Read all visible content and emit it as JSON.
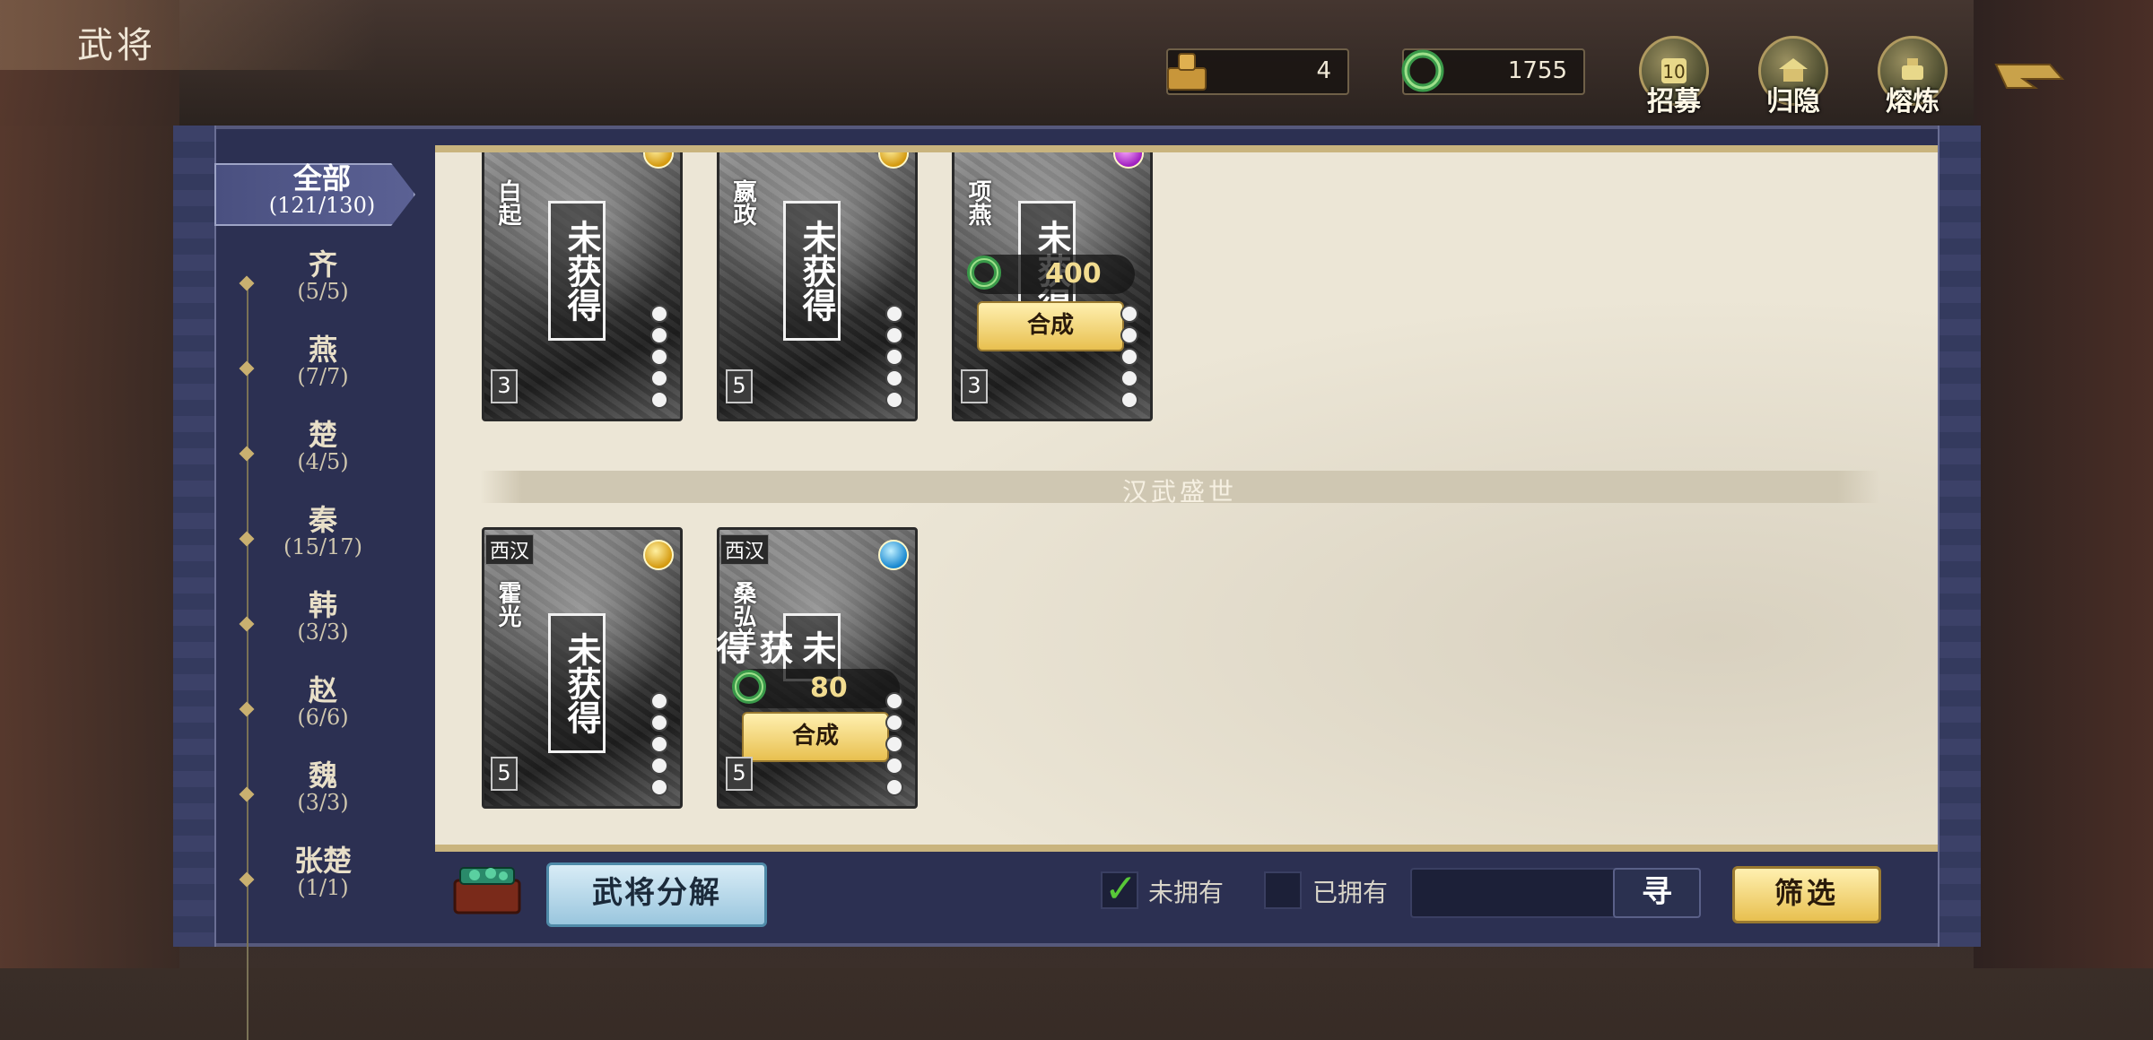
{
  "header": {
    "title": "武将",
    "currency_token": {
      "icon": "seal-token-icon",
      "value": "4"
    },
    "currency_jade": {
      "icon": "jade-ring-icon",
      "value": "1755"
    },
    "buttons": [
      {
        "label": "招募",
        "icon": "recruit-icon"
      },
      {
        "label": "归隐",
        "icon": "retire-house-icon"
      },
      {
        "label": "熔炼",
        "icon": "smelt-cauldron-icon"
      }
    ],
    "back_icon": "back-arrow-icon"
  },
  "sidebar": {
    "items": [
      {
        "name": "全部",
        "count": "(121/130)",
        "active": true
      },
      {
        "name": "齐",
        "count": "(5/5)"
      },
      {
        "name": "燕",
        "count": "(7/7)"
      },
      {
        "name": "楚",
        "count": "(4/5)"
      },
      {
        "name": "秦",
        "count": "(15/17)"
      },
      {
        "name": "韩",
        "count": "(3/3)"
      },
      {
        "name": "赵",
        "count": "(6/6)"
      },
      {
        "name": "魏",
        "count": "(3/3)"
      },
      {
        "name": "张楚",
        "count": "(1/1)"
      }
    ]
  },
  "cards_row1": [
    {
      "name": "白起",
      "status": "未获得",
      "level": "3",
      "gem": "gold"
    },
    {
      "name": "嬴政",
      "status": "未获得",
      "level": "5",
      "gem": "gold"
    },
    {
      "name": "项燕",
      "status": "未获得",
      "level": "3",
      "gem": "purple",
      "cost": "400",
      "synth_label": "合成"
    }
  ],
  "section_title": "汉武盛世",
  "cards_row2": [
    {
      "era": "西汉",
      "name": "霍光",
      "status": "未获得",
      "level": "5",
      "gem": "gold"
    },
    {
      "era": "西汉",
      "name": "桑弘羊",
      "status": "未获得",
      "level": "5",
      "gem": "blue",
      "cost": "80",
      "synth_label": "合成"
    }
  ],
  "bottom": {
    "decompose_label": "武将分解",
    "not_owned_label": "未拥有",
    "not_owned_checked": true,
    "owned_label": "已拥有",
    "owned_checked": false,
    "search_value": "",
    "search_btn_label": "寻",
    "filter_label": "筛选"
  },
  "colors": {
    "panel": "#2c3052",
    "content_bg": "#ece6d6",
    "gold_button": "#e8c050",
    "decompose_button": "#9ac6de",
    "check_green": "#58c838"
  }
}
